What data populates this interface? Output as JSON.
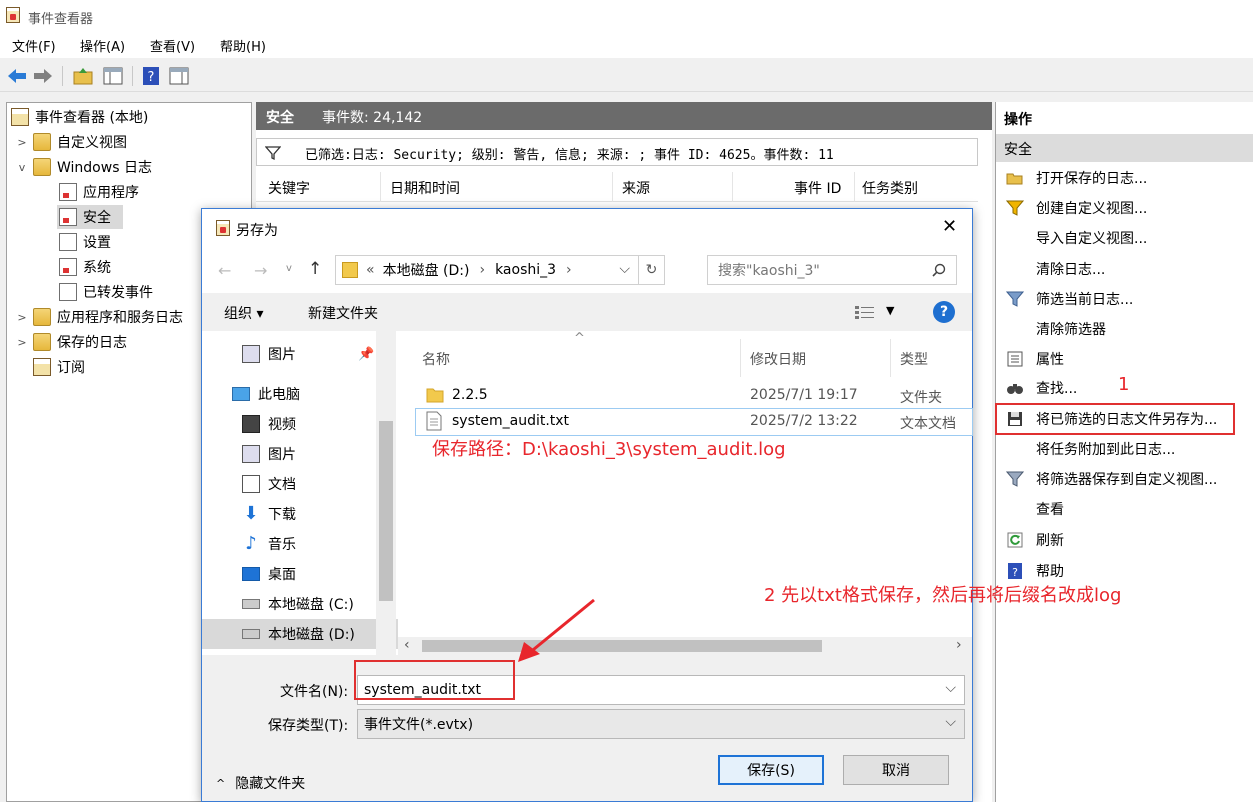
{
  "window": {
    "title": "事件查看器"
  },
  "menu": [
    "文件(F)",
    "操作(A)",
    "查看(V)",
    "帮助(H)"
  ],
  "tree": [
    {
      "label": "事件查看器 (本地)",
      "icon": "event-viewer-icon"
    },
    {
      "label": "自定义视图",
      "icon": "folder-icon"
    },
    {
      "label": "Windows 日志",
      "icon": "folder-icon"
    },
    {
      "label": "应用程序",
      "icon": "log-icon"
    },
    {
      "label": "安全",
      "icon": "log-icon"
    },
    {
      "label": "设置",
      "icon": "log-icon"
    },
    {
      "label": "系统",
      "icon": "log-icon"
    },
    {
      "label": "已转发事件",
      "icon": "log-icon"
    },
    {
      "label": "应用程序和服务日志",
      "icon": "folder-icon"
    },
    {
      "label": "保存的日志",
      "icon": "folder-icon"
    },
    {
      "label": "订阅",
      "icon": "subscription-icon"
    }
  ],
  "middle": {
    "log_name": "安全",
    "event_count_label": "事件数: 24,142",
    "filter_text": "已筛选:日志: Security; 级别: 警告, 信息; 来源: ; 事件 ID: 4625。事件数: 11",
    "columns": [
      "关键字",
      "日期和时间",
      "来源",
      "事件 ID",
      "任务类别"
    ]
  },
  "actions": {
    "title": "操作",
    "section": "安全",
    "items": [
      "打开保存的日志...",
      "创建自定义视图...",
      "导入自定义视图...",
      "清除日志...",
      "筛选当前日志...",
      "清除筛选器",
      "属性",
      "查找...",
      "将已筛选的日志文件另存为...",
      "将任务附加到此日志...",
      "将筛选器保存到自定义视图...",
      "查看",
      "刷新",
      "帮助"
    ]
  },
  "dialog": {
    "title": "另存为",
    "path_prefix": "«",
    "path": [
      "本地磁盘 (D:)",
      "kaoshi_3"
    ],
    "search_placeholder": "搜索\"kaoshi_3\"",
    "organize": "组织 ▾",
    "new_folder": "新建文件夹",
    "nav": [
      {
        "label": "图片",
        "icon": "pictures-icon"
      },
      {
        "label": "此电脑",
        "icon": "computer-icon"
      },
      {
        "label": "视频",
        "icon": "videos-icon"
      },
      {
        "label": "图片",
        "icon": "pictures-icon"
      },
      {
        "label": "文档",
        "icon": "documents-icon"
      },
      {
        "label": "下载",
        "icon": "download-icon"
      },
      {
        "label": "音乐",
        "icon": "music-icon"
      },
      {
        "label": "桌面",
        "icon": "desktop-icon"
      },
      {
        "label": "本地磁盘 (C:)",
        "icon": "drive-icon"
      },
      {
        "label": "本地磁盘 (D:)",
        "icon": "drive-icon"
      }
    ],
    "file_columns": [
      "名称",
      "修改日期",
      "类型"
    ],
    "files": [
      {
        "name": "2.2.5",
        "date": "2025/7/1 19:17",
        "type": "文件夹"
      },
      {
        "name": "system_audit.txt",
        "date": "2025/7/2 13:22",
        "type": "文本文档"
      }
    ],
    "filename_label": "文件名(N):",
    "filename_value": "system_audit.txt",
    "filetype_label": "保存类型(T):",
    "filetype_value": "事件文件(*.evtx)",
    "hide_folders": "隐藏文件夹",
    "save_button": "保存(S)",
    "cancel_button": "取消"
  },
  "annotations": {
    "path_note": "保存路径：D:\\kaoshi_3\\system_audit.log",
    "step1": "1",
    "step2": "2 先以txt格式保存，然后再将后缀名改成log"
  },
  "colors": {
    "annotation": "#e8262c",
    "accent": "#3a7bd5"
  }
}
